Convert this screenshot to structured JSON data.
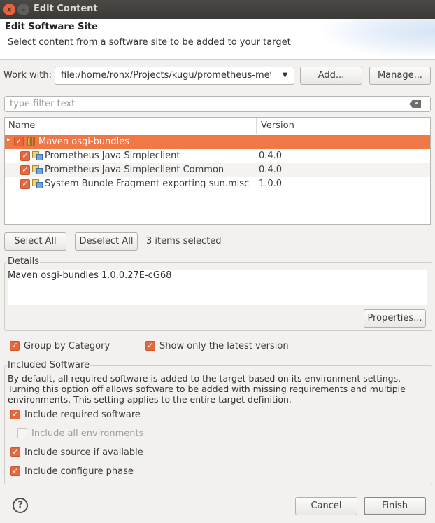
{
  "window": {
    "title": "Edit Content",
    "close_glyph": "×",
    "minimize_glyph": "–"
  },
  "banner": {
    "title": "Edit Software Site",
    "description": "Select content from a software site to be added to your target"
  },
  "work_with": {
    "label": "Work with:",
    "value": "file:/home/ronx/Projects/kugu/prometheus-metrics",
    "add_label": "Add...",
    "manage_label": "Manage..."
  },
  "filter": {
    "placeholder": "type filter text"
  },
  "tree": {
    "columns": [
      "Name",
      "Version"
    ],
    "category": {
      "name": "Maven osgi-bundles",
      "checked": true,
      "expanded": true
    },
    "items": [
      {
        "name": "Prometheus Java Simpleclient",
        "version": "0.4.0",
        "checked": true
      },
      {
        "name": "Prometheus Java Simpleclient Common",
        "version": "0.4.0",
        "checked": true
      },
      {
        "name": "System Bundle Fragment exporting sun.misc",
        "version": "1.0.0",
        "checked": true
      }
    ]
  },
  "selection": {
    "select_all_label": "Select All",
    "deselect_all_label": "Deselect All",
    "status": "3 items selected"
  },
  "details": {
    "title": "Details",
    "text": "Maven osgi-bundles 1.0.0.27E-cG68",
    "properties_label": "Properties..."
  },
  "options": {
    "group_by_category": {
      "label": "Group by Category",
      "checked": true
    },
    "show_latest_only": {
      "label": "Show only the latest version",
      "checked": true
    }
  },
  "included_software": {
    "title": "Included Software",
    "description": "By default, all required software is added to the target based on its environment settings. Turning this option off allows software to be added with missing requirements and multiple environments.  This setting applies to the entire target definition.",
    "include_required": {
      "label": "Include required software",
      "checked": true
    },
    "include_all_env": {
      "label": "Include all environments",
      "checked": false,
      "enabled": false
    },
    "include_source": {
      "label": "Include source if available",
      "checked": true
    },
    "include_configure": {
      "label": "Include configure phase",
      "checked": true
    }
  },
  "footer": {
    "help_glyph": "?",
    "cancel_label": "Cancel",
    "finish_label": "Finish"
  },
  "colors": {
    "accent": "#f07746",
    "checkbox": "#e6683c",
    "titlebar": "#3b3a36"
  }
}
